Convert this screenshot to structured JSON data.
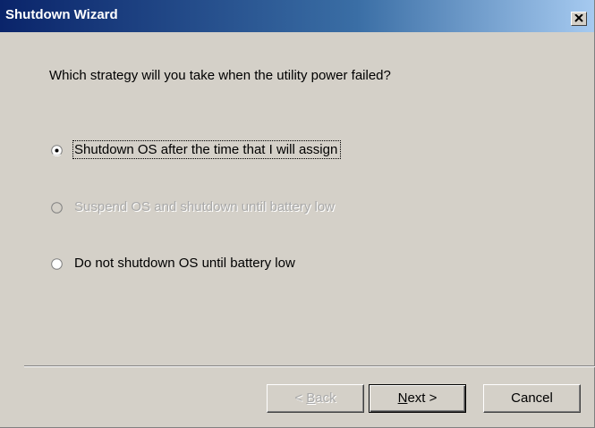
{
  "window": {
    "title": "Shutdown Wizard"
  },
  "question": "Which strategy will you take when the utility power failed?",
  "options": [
    {
      "label": "Shutdown OS after the time that I will assign",
      "selected": true,
      "enabled": true
    },
    {
      "label": "Suspend OS and shutdown until battery low",
      "selected": false,
      "enabled": false
    },
    {
      "label": "Do not shutdown OS until battery low",
      "selected": false,
      "enabled": true
    }
  ],
  "buttons": {
    "back_prefix": "< ",
    "back_key": "B",
    "back_rest": "ack",
    "next_key": "N",
    "next_rest": "ext >",
    "cancel": "Cancel"
  },
  "colors": {
    "titlebar_start": "#0a246a",
    "titlebar_end": "#a6caf0",
    "face": "#d4d0c8",
    "disabled_text": "#a9a9a9"
  },
  "icons": {
    "close": "close-icon",
    "radio_selected": "radio-selected-icon",
    "radio_unselected": "radio-unselected-icon"
  }
}
